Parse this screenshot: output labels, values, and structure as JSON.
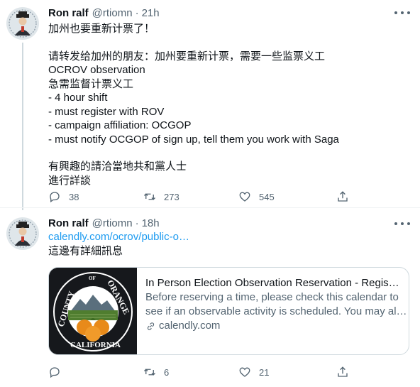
{
  "tweets": [
    {
      "name": "Ron ralf",
      "handle": "@rtiomn",
      "separator": "·",
      "time": "21h",
      "lines": [
        "加州也要重新计票了！",
        "",
        "请转发给加州的朋友：加州要重新计票，需要一些监票义工",
        "OCROV observation",
        "急需监督计票义工",
        "- 4 hour shift",
        "- must register with ROV",
        "- campaign affiliation: OCGOP",
        "- must notify OCGOP of sign up, tell them you work with Saga",
        "",
        "有興趣的請洽當地共和黨人士",
        "進行詳談"
      ],
      "replies": "38",
      "retweets": "273",
      "likes": "545"
    },
    {
      "name": "Ron ralf",
      "handle": "@rtiomn",
      "separator": "·",
      "time": "18h",
      "link": "calendly.com/ocrov/public-o…",
      "text": "這邊有詳細訊息",
      "card": {
        "title": "In Person Election Observation Reservation - Registra…",
        "description_line1": "Before reserving a time, please check this calendar to",
        "description_line2": "see if an observable activity is scheduled. You may al…",
        "domain": "calendly.com",
        "seal_top_left": "COUNTY",
        "seal_top_mid": "OF",
        "seal_top_right": "ORANGE",
        "seal_bottom": "CALIFORNIA"
      },
      "replies": "",
      "retweets": "6",
      "likes": "21"
    }
  ],
  "colors": {
    "accent": "#1d9bf0",
    "secondary_text": "#536471",
    "border": "#cfd9de",
    "seal_green": "#4f7d2f",
    "seal_orange": "#e88a1a"
  },
  "icons": [
    "more-icon",
    "reply-icon",
    "retweet-icon",
    "like-icon",
    "share-icon",
    "link-icon"
  ]
}
